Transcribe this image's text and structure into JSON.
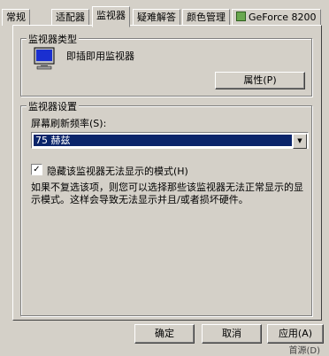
{
  "tabs": [
    {
      "label": "常规"
    },
    {
      "label": "适配器"
    },
    {
      "label": "监视器"
    },
    {
      "label": "疑难解答"
    },
    {
      "label": "颜色管理"
    },
    {
      "label": "GeForce 8200"
    }
  ],
  "monitor_type": {
    "group_title": "监视器类型",
    "monitor_name": "即插即用监视器",
    "properties_button": "属性(P)"
  },
  "monitor_settings": {
    "group_title": "监视器设置",
    "refresh_label": "屏幕刷新频率(S):",
    "refresh_value": "75 赫兹",
    "hide_modes_label": "隐藏该监视器无法显示的模式(H)",
    "hide_modes_checked": true,
    "explanation": "如果不复选该项，则您可以选择那些该监视器无法正常显示的显示模式。这样会导致无法显示并且/或者损坏硬件。"
  },
  "buttons": {
    "ok": "确定",
    "cancel": "取消",
    "apply": "应用(A)"
  },
  "bottom_text": "首源(D)",
  "colors": {
    "selection": "#0a246a",
    "face": "#d4d0c8"
  }
}
